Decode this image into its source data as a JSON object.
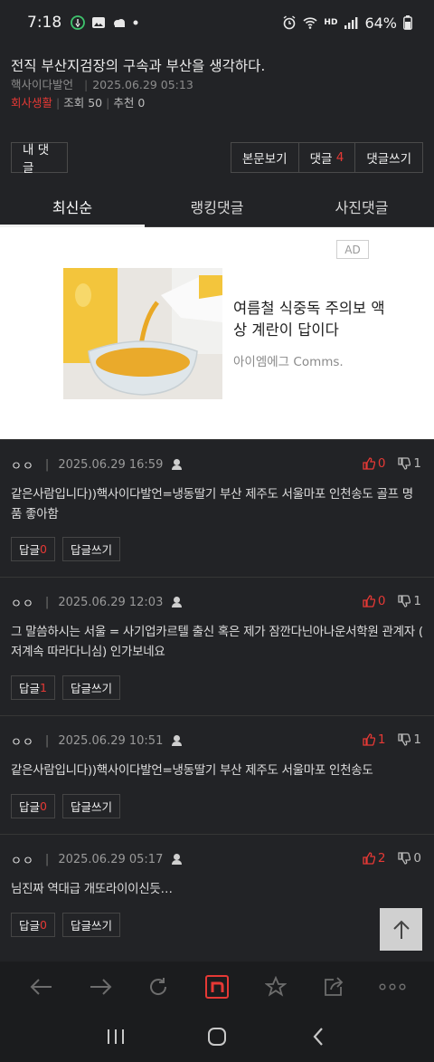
{
  "status_bar": {
    "time": "7:18",
    "battery": "64%",
    "network_label": "HD"
  },
  "post": {
    "title": "전직 부산지검장의 구속과 부산을 생각하다.",
    "author": "핵사이다발언",
    "datetime": "2025.06.29 05:13",
    "category": "회사생활",
    "views_label": "조회 50",
    "recommend_label": "추천 0"
  },
  "actions": {
    "my_comments": "내 댓글",
    "view_post": "본문보기",
    "comments_label": "댓글",
    "comments_count": "4",
    "write_comment": "댓글쓰기"
  },
  "tabs": [
    {
      "label": "최신순",
      "active": true
    },
    {
      "label": "랭킹댓글",
      "active": false
    },
    {
      "label": "사진댓글",
      "active": false
    }
  ],
  "ad": {
    "badge": "AD",
    "title": "여름철 식중독 주의보 액상 계란이 답이다",
    "advertiser": "아이엠에그 Comms."
  },
  "comments": [
    {
      "nick": "ㅇㅇ",
      "datetime": "2025.06.29 16:59",
      "up": "0",
      "down": "1",
      "text": "같은사람입니다))핵사이다발언=냉동딸기 부산 제주도 서울마포 인천송도 골프 명품 좋아함",
      "reply_label": "답글",
      "reply_count": "0",
      "write_reply": "답글쓰기"
    },
    {
      "nick": "ㅇㅇ",
      "datetime": "2025.06.29 12:03",
      "up": "0",
      "down": "1",
      "text": "그 말씀하시는 서울 = 사기업카르텔 출신 혹은 제가 잠깐다닌아나운서학원 관계자 ( 저계속 따라다니심) 인가보네요",
      "reply_label": "답글",
      "reply_count": "1",
      "write_reply": "답글쓰기"
    },
    {
      "nick": "ㅇㅇ",
      "datetime": "2025.06.29 10:51",
      "up": "1",
      "down": "1",
      "text": "같은사람입니다))핵사이다발언=냉동딸기 부산 제주도 서울마포 인천송도",
      "reply_label": "답글",
      "reply_count": "0",
      "write_reply": "답글쓰기"
    },
    {
      "nick": "ㅇㅇ",
      "datetime": "2025.06.29 05:17",
      "up": "2",
      "down": "0",
      "text": "님진짜 역대급 개또라이이신듯…",
      "reply_label": "답글",
      "reply_count": "0",
      "write_reply": "답글쓰기"
    }
  ],
  "colors": {
    "background": "#222326",
    "accent_red": "#e53935",
    "app_logo": "#e53935"
  },
  "icons": {
    "toolbar": [
      "back-arrow-icon",
      "forward-arrow-icon",
      "refresh-icon",
      "nate-logo-icon",
      "star-icon",
      "share-icon",
      "more-icon"
    ],
    "nav": [
      "recent-apps-icon",
      "home-icon",
      "back-icon"
    ]
  }
}
